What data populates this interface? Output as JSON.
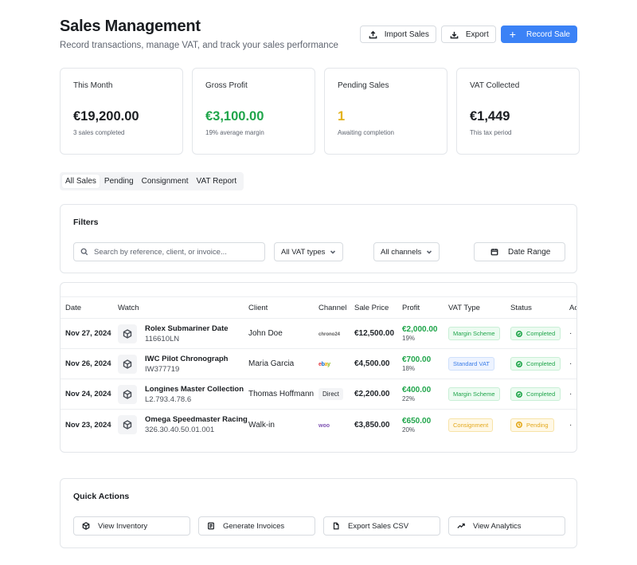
{
  "header": {
    "title": "Sales Management",
    "subtitle": "Record transactions, manage VAT, and track your sales performance"
  },
  "actions": {
    "import_label": "Import Sales",
    "export_label": "Export",
    "record_label": "Record Sale"
  },
  "stats": [
    {
      "label": "This Month",
      "value": "€19,200.00",
      "sub": "3 sales completed"
    },
    {
      "label": "Gross Profit",
      "value": "€3,100.00",
      "sub": "19% average margin"
    },
    {
      "label": "Pending Sales",
      "value": "1",
      "sub": "Awaiting completion"
    },
    {
      "label": "VAT Collected",
      "value": "€1,449",
      "sub": "This tax period"
    }
  ],
  "colors": {
    "accent": "#3b82f6",
    "profit_green": "#1fa54a",
    "pending_yellow": "#e3b21c"
  },
  "tabs": [
    "All Sales",
    "Pending",
    "Consignment",
    "VAT Report"
  ],
  "filters": {
    "title": "Filters",
    "search_placeholder": "Search by reference, client, or invoice...",
    "vat_select": "All VAT types",
    "channel_select": "All channels",
    "date_label": "Date Range"
  },
  "table": {
    "columns": [
      "Date",
      "Watch",
      "Client",
      "Channel",
      "Sale Price",
      "Profit",
      "VAT Type",
      "Status",
      "Ac"
    ],
    "rows": [
      {
        "date": "Nov 27, 2024",
        "watch": "Rolex Submariner Date",
        "ref": "116610LN",
        "client": "John Doe",
        "channel": "chrono24",
        "channel_icon": "chrono24-logo",
        "price": "€12,500.00",
        "profit": "€2,000.00",
        "margin": "19%",
        "vat": "Margin Scheme",
        "status": "Completed"
      },
      {
        "date": "Nov 26, 2024",
        "watch": "IWC Pilot Chronograph",
        "ref": "IW377719",
        "client": "Maria Garcia",
        "channel": "ebay",
        "channel_icon": "ebay-logo",
        "price": "€4,500.00",
        "profit": "€700.00",
        "margin": "18%",
        "vat": "Standard VAT",
        "status": "Completed"
      },
      {
        "date": "Nov 24, 2024",
        "watch": "Longines Master Collection",
        "ref": "L2.793.4.78.6",
        "client": "Thomas Hoffmann",
        "channel": "Direct",
        "channel_icon": "direct-badge",
        "price": "€2,200.00",
        "profit": "€400.00",
        "margin": "22%",
        "vat": "Margin Scheme",
        "status": "Completed"
      },
      {
        "date": "Nov 23, 2024",
        "watch": "Omega Speedmaster Racing",
        "ref": "326.30.40.50.01.001",
        "client": "Walk-in",
        "channel": "woo",
        "channel_icon": "woocommerce-logo",
        "price": "€3,850.00",
        "profit": "€650.00",
        "margin": "20%",
        "vat": "Consignment",
        "status": "Pending"
      }
    ]
  },
  "quick_actions": {
    "title": "Quick Actions",
    "items": [
      "View Inventory",
      "Generate Invoices",
      "Export Sales CSV",
      "View Analytics"
    ]
  }
}
